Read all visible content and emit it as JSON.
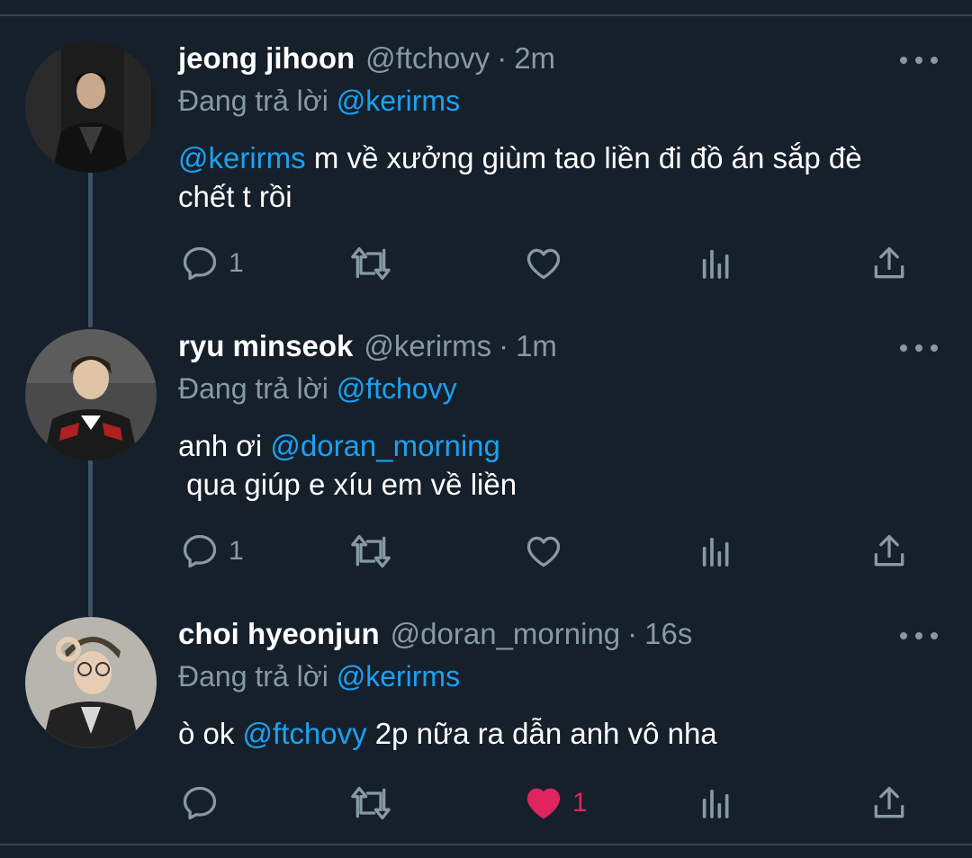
{
  "reply_prefix": "Đang trả lời",
  "tweets": [
    {
      "name": "jeong jihoon",
      "handle": "@ftchovy",
      "time": "2m",
      "reply_to": "@kerirms",
      "body_lines": [
        {
          "mention": "@kerirms",
          "text": " m về xưởng giùm tao liền đi đồ án sắp đè"
        },
        {
          "mention": "",
          "text": "chết t rồi"
        }
      ],
      "reply_count": "1",
      "like_count": "",
      "liked": false,
      "avatar_icon": "person-avatar"
    },
    {
      "name": "ryu minseok",
      "handle": "@kerirms",
      "time": "1m",
      "reply_to": "@ftchovy",
      "body_lines": [
        {
          "prefix": "anh ơi ",
          "mention": "@doran_morning",
          "text": ""
        },
        {
          "prefix": " qua giúp e xíu em về liền",
          "mention": "",
          "text": ""
        }
      ],
      "reply_count": "1",
      "like_count": "",
      "liked": false,
      "avatar_icon": "person-avatar"
    },
    {
      "name": "choi hyeonjun",
      "handle": "@doran_morning",
      "time": "16s",
      "reply_to": "@kerirms",
      "body_lines": [
        {
          "prefix": "ò ok ",
          "mention": "@ftchovy",
          "text": " 2p nữa ra dẫn anh vô nha"
        }
      ],
      "reply_count": "",
      "like_count": "1",
      "liked": true,
      "avatar_icon": "person-avatar"
    }
  ],
  "colors": {
    "background": "#15202b",
    "secondary_text": "#8899a6",
    "link": "#1da1f2",
    "like_active": "#e0245e"
  }
}
